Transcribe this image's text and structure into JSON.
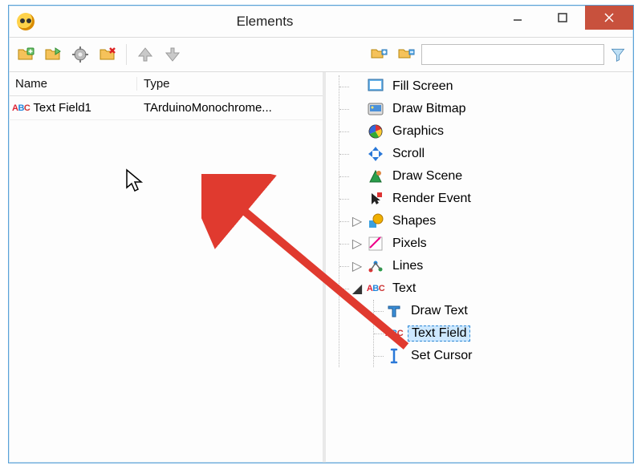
{
  "window": {
    "title": "Elements"
  },
  "list": {
    "columns": {
      "name": "Name",
      "type": "Type"
    },
    "rows": [
      {
        "name": "Text Field1",
        "type": "TArduinoMonochrome..."
      }
    ]
  },
  "tree": {
    "items": [
      {
        "label": "Fill Screen",
        "icon": "fill-screen-icon"
      },
      {
        "label": "Draw Bitmap",
        "icon": "draw-bitmap-icon"
      },
      {
        "label": "Graphics",
        "icon": "graphics-icon"
      },
      {
        "label": "Scroll",
        "icon": "scroll-icon"
      },
      {
        "label": "Draw Scene",
        "icon": "draw-scene-icon"
      },
      {
        "label": "Render Event",
        "icon": "render-event-icon"
      },
      {
        "label": "Shapes",
        "icon": "shapes-icon",
        "expandable": true
      },
      {
        "label": "Pixels",
        "icon": "pixels-icon",
        "expandable": true
      },
      {
        "label": "Lines",
        "icon": "lines-icon",
        "expandable": true
      },
      {
        "label": "Text",
        "icon": "text-icon",
        "expanded": true,
        "children": [
          {
            "label": "Draw Text",
            "icon": "draw-text-icon"
          },
          {
            "label": "Text Field",
            "icon": "text-field-icon",
            "selected": true
          },
          {
            "label": "Set Cursor",
            "icon": "set-cursor-icon"
          }
        ]
      }
    ]
  }
}
